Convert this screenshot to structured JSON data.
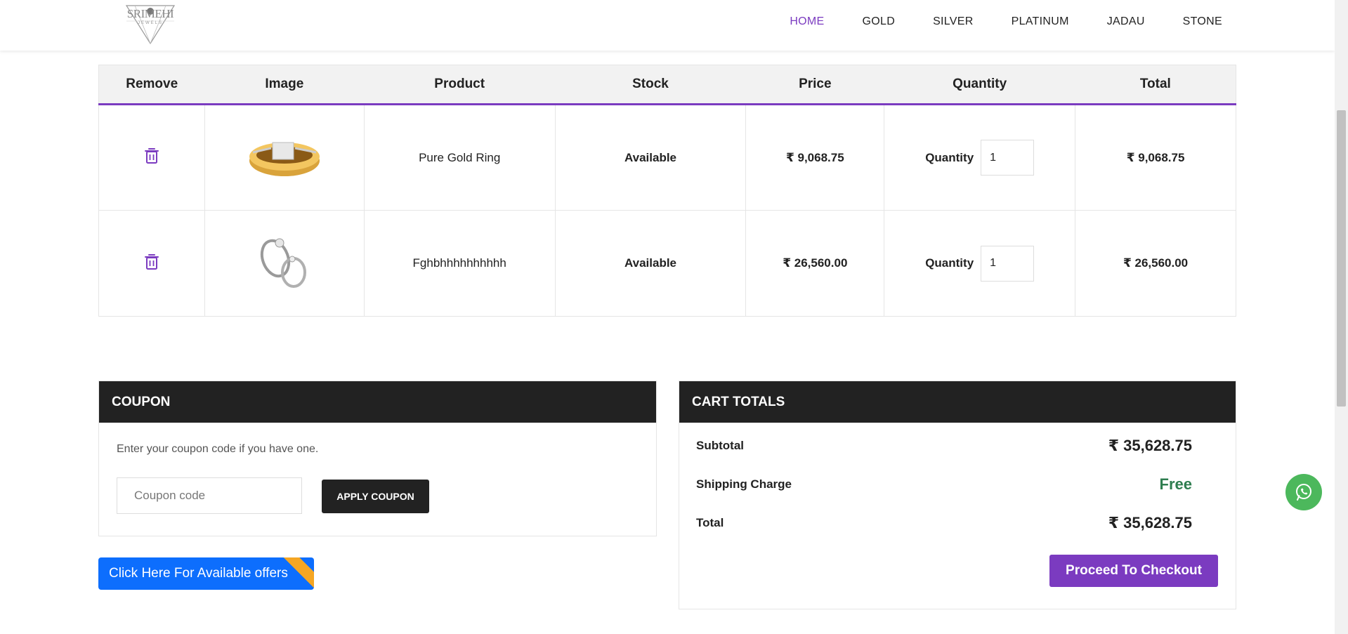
{
  "brand": {
    "name": "SRIMEHI",
    "sub": "JEWELS"
  },
  "nav": [
    {
      "label": "HOME",
      "active": true
    },
    {
      "label": "GOLD"
    },
    {
      "label": "SILVER"
    },
    {
      "label": "PLATINUM"
    },
    {
      "label": "JADAU"
    },
    {
      "label": "STONE"
    }
  ],
  "table": {
    "headers": [
      "Remove",
      "Image",
      "Product",
      "Stock",
      "Price",
      "Quantity",
      "Total"
    ],
    "rows": [
      {
        "product": "Pure Gold Ring",
        "stock": "Available",
        "price": "₹ 9,068.75",
        "qty_label": "Quantity",
        "qty": "1",
        "total": "₹ 9,068.75"
      },
      {
        "product": "Fghbhhhhhhhhhh",
        "stock": "Available",
        "price": "₹ 26,560.00",
        "qty_label": "Quantity",
        "qty": "1",
        "total": "₹ 26,560.00"
      }
    ]
  },
  "coupon": {
    "title": "COUPON",
    "text": "Enter your coupon code if you have one.",
    "placeholder": "Coupon code",
    "apply_label": "APPLY COUPON",
    "offers_label": "Click Here For Available offers"
  },
  "totals": {
    "title": "CART TOTALS",
    "subtotal_label": "Subtotal",
    "subtotal": "₹ 35,628.75",
    "shipping_label": "Shipping Charge",
    "shipping": "Free",
    "total_label": "Total",
    "total": "₹ 35,628.75",
    "checkout_label": "Proceed To Checkout"
  },
  "colors": {
    "accent": "#7b3bc0",
    "dark": "#222222",
    "success": "#2e7d4f",
    "offers": "#0d6efd",
    "whatsapp": "#4cb85c"
  },
  "icons": {
    "remove": "trash-icon",
    "whatsapp": "whatsapp-icon"
  }
}
